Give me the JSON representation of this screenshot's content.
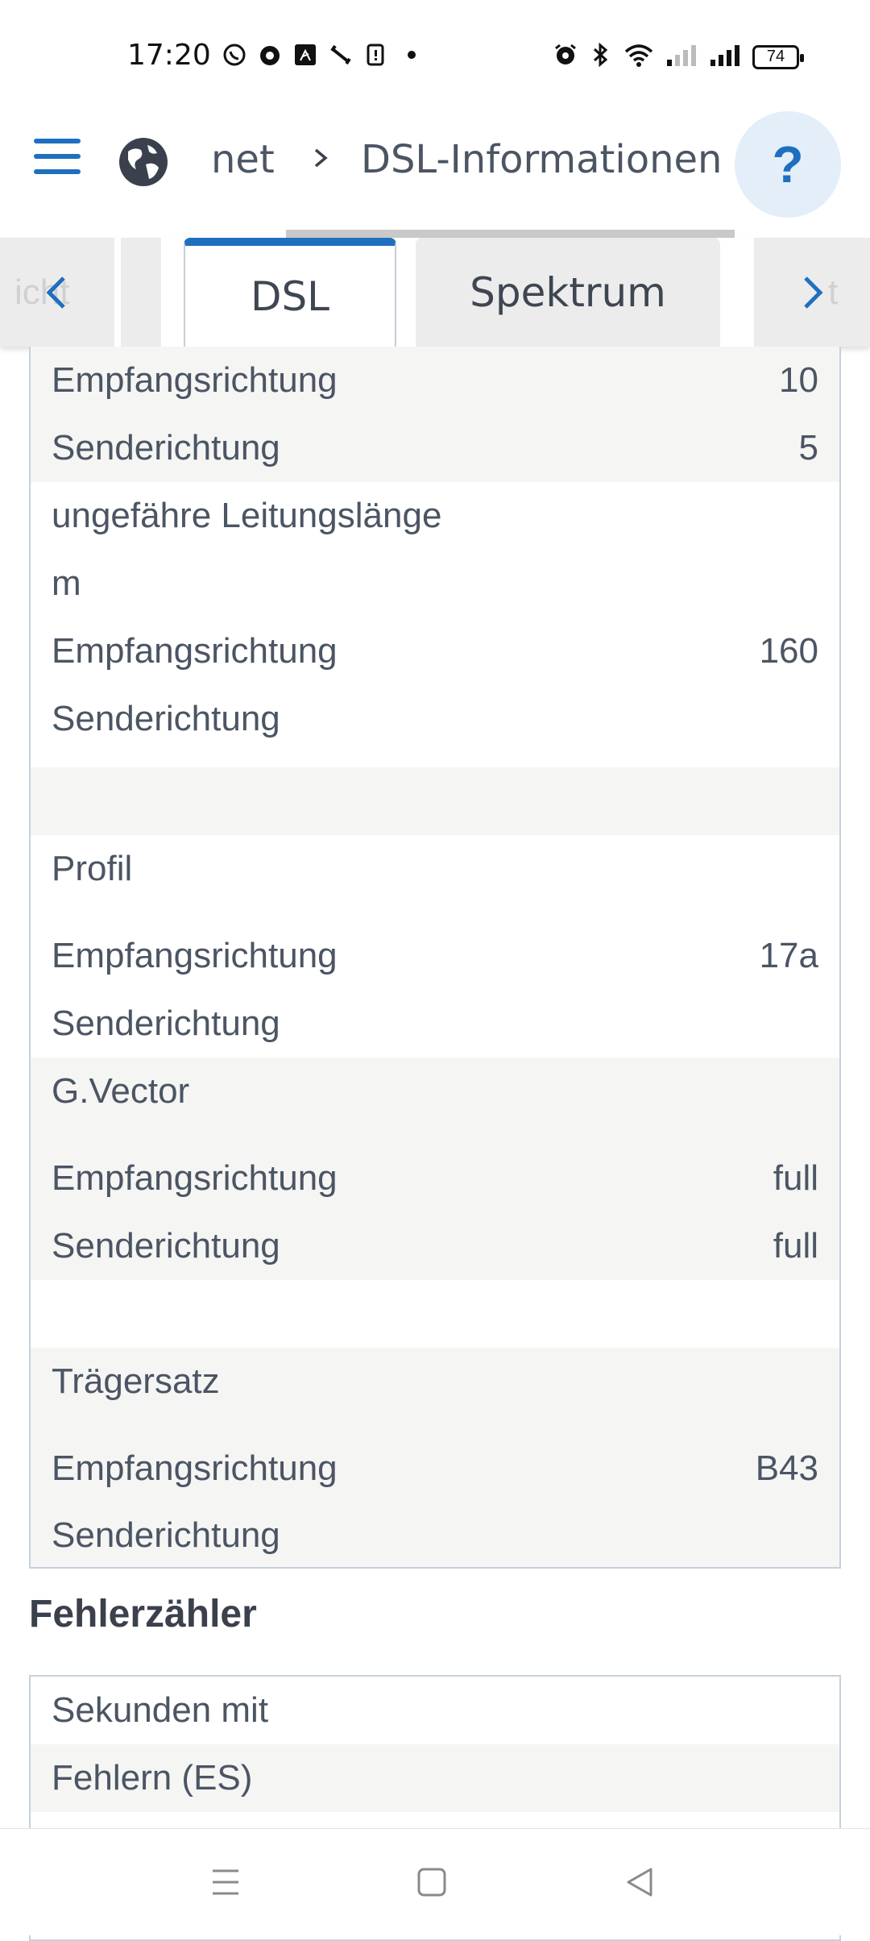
{
  "status": {
    "time": "17:20",
    "battery": "74"
  },
  "header": {
    "breadcrumb_prev": "net",
    "breadcrumb_current": "DSL-Informationen",
    "help_label": "?"
  },
  "tabs": {
    "left_ghost": "icht",
    "right_ghost": "t",
    "items": [
      {
        "label": "DSL",
        "active": true
      },
      {
        "label": "Spektrum",
        "active": false
      }
    ]
  },
  "table": {
    "rows": [
      {
        "label": "Empfangsrichtung",
        "value": "10"
      },
      {
        "label": "Senderichtung",
        "value": "5"
      },
      {
        "label": "ungefähre Leitungslänge",
        "value": ""
      },
      {
        "label": "m",
        "value": ""
      },
      {
        "label": "Empfangsrichtung",
        "value": "160"
      },
      {
        "label": "Senderichtung",
        "value": ""
      },
      {
        "label": "",
        "value": ""
      },
      {
        "label": "Profil",
        "value": ""
      },
      {
        "label": "Empfangsrichtung",
        "value": "17a"
      },
      {
        "label": "Senderichtung",
        "value": ""
      },
      {
        "label": "G.Vector",
        "value": ""
      },
      {
        "label": "Empfangsrichtung",
        "value": "full"
      },
      {
        "label": "Senderichtung",
        "value": "full"
      },
      {
        "label": "",
        "value": ""
      },
      {
        "label": "Trägersatz",
        "value": ""
      },
      {
        "label": "Empfangsrichtung",
        "value": "B43"
      },
      {
        "label": "Senderichtung",
        "value": ""
      }
    ]
  },
  "errors": {
    "title": "Fehlerzähler",
    "rows": [
      {
        "label": "Sekunden mit"
      },
      {
        "label": "Fehlern (ES)"
      }
    ]
  },
  "colors": {
    "accent": "#1f6fc1",
    "row_grey": "#f5f5f4",
    "text": "#4b5563"
  }
}
